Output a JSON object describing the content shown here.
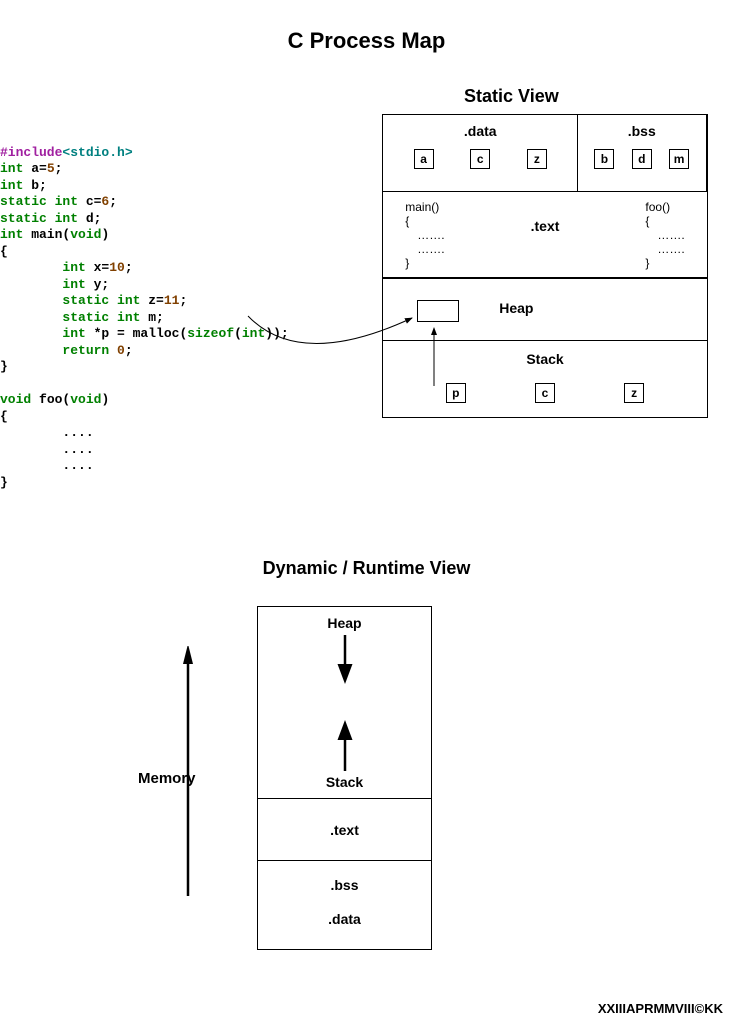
{
  "title": "C Process Map",
  "static_title": "Static View",
  "code": {
    "l1": {
      "include": "#include",
      "hdr": "<stdio.h>"
    },
    "l2": {
      "kw": "int",
      "rest": " a=",
      "num": "5",
      "semi": ";"
    },
    "l3": {
      "kw": "int",
      "rest": " b;"
    },
    "l4": {
      "kw": "static int",
      "rest": " c=",
      "num": "6",
      "semi": ";"
    },
    "l5": {
      "kw": "static int",
      "rest": " d;"
    },
    "l6": {
      "kw": "int",
      "name": " main(",
      "void": "void",
      "close": ")"
    },
    "l7": "{",
    "l8": {
      "indent": "        ",
      "kw": "int",
      "rest": " x=",
      "num": "10",
      "semi": ";"
    },
    "l9": {
      "indent": "        ",
      "kw": "int",
      "rest": " y;"
    },
    "l10": {
      "indent": "        ",
      "kw": "static int",
      "rest": " z=",
      "num": "11",
      "semi": ";"
    },
    "l11": {
      "indent": "        ",
      "kw": "static int",
      "rest": " m;"
    },
    "l12": {
      "indent": "        ",
      "kw": "int",
      "rest": " *p = malloc(",
      "sizeof": "sizeof",
      "paren": "(",
      "int2": "int",
      "close": "));"
    },
    "l13": {
      "indent": "        ",
      "kw": "return",
      "sp": " ",
      "num": "0",
      "semi": ";"
    },
    "l14": "}",
    "l15": "",
    "l16": {
      "kw": "void",
      "name": " foo(",
      "void2": "void",
      "close": ")"
    },
    "l17": "{",
    "l18": "        ....",
    "l19": "        ....",
    "l20": "        ....",
    "l21": "}"
  },
  "static": {
    "data_label": ".data",
    "bss_label": ".bss",
    "data_vars": [
      "a",
      "c",
      "z"
    ],
    "bss_vars": [
      "b",
      "d",
      "m"
    ],
    "text_label": ".text",
    "main_fn": "main()",
    "foo_fn": "foo()",
    "brace_open": "{",
    "brace_close": "}",
    "dots": "…….",
    "heap_label": "Heap",
    "stack_label": "Stack",
    "stack_vars": [
      "p",
      "c",
      "z"
    ]
  },
  "dynamic": {
    "title": "Dynamic / Runtime View",
    "heap": "Heap",
    "stack": "Stack",
    "text": ".text",
    "bss": ".bss",
    "data": ".data",
    "memory": "Memory"
  },
  "footer": "XXIIIAPRMMVIII©KK"
}
